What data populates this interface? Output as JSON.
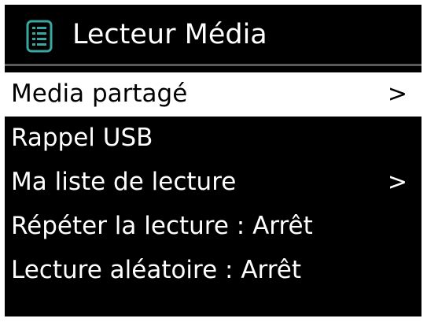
{
  "header": {
    "title": "Lecteur Média",
    "icon": "list-icon",
    "accent_color": "#3aa6a0"
  },
  "menu": {
    "selected_index": 0,
    "items": [
      {
        "label": "Media partagé",
        "arrow": ">"
      },
      {
        "label": "Rappel USB",
        "arrow": ""
      },
      {
        "label": "Ma liste de lecture",
        "arrow": ">"
      },
      {
        "label": "Répéter la lecture : Arrêt",
        "arrow": ""
      },
      {
        "label": "Lecture aléatoire : Arrêt",
        "arrow": ""
      }
    ]
  }
}
